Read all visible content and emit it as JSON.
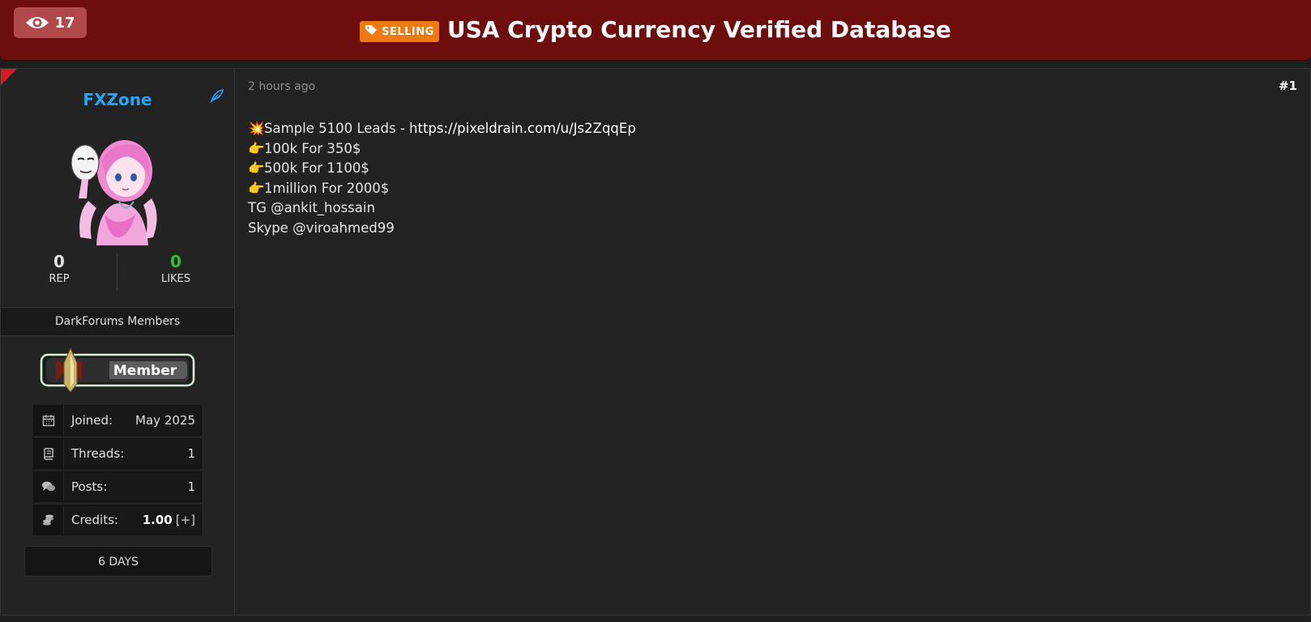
{
  "header": {
    "views": "17",
    "prefix": "SELLING",
    "title": "USA Crypto Currency Verified Database",
    "accent": "#6e0d0d"
  },
  "author": {
    "username": "FXZone",
    "rep_value": "0",
    "rep_label": "REP",
    "likes_value": "0",
    "likes_label": "LIKES",
    "group": "DarkForums Members",
    "rank": "Member",
    "info": [
      {
        "icon": "calendar-icon",
        "label": "Joined:",
        "value": "May 2025"
      },
      {
        "icon": "book-icon",
        "label": "Threads:",
        "value": "1"
      },
      {
        "icon": "comments-icon",
        "label": "Posts:",
        "value": "1"
      },
      {
        "icon": "coins-icon",
        "label": "Credits:",
        "value": "1.00",
        "extra": "[+]"
      }
    ],
    "days": "6 DAYS"
  },
  "post": {
    "time": "2 hours ago",
    "number": "#1",
    "lines": [
      {
        "emoji": "💥",
        "text": "Sample 5100 Leads - ",
        "link": "https://pixeldrain.com/u/Js2ZqqEp"
      },
      {
        "emoji": "👉",
        "text": "100k For 350$"
      },
      {
        "emoji": "👉",
        "text": "500k For 1100$"
      },
      {
        "emoji": "👉",
        "text": "1million For 2000$"
      },
      {
        "emoji": "",
        "text": "TG @ankit_hossain"
      },
      {
        "emoji": "",
        "text": "Skype @viroahmed99"
      }
    ]
  }
}
